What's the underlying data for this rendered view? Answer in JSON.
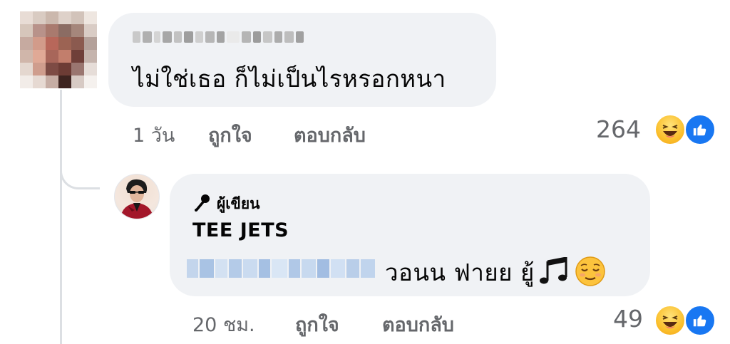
{
  "comment": {
    "text": "ไม่ใช่เธอ ก็ไม่เป็นไรหรอกหนา",
    "time": "1 วัน",
    "like_label": "ถูกใจ",
    "reply_label": "ตอบกลับ",
    "reaction_count": "264",
    "reactions": [
      "haha-icon",
      "like-icon"
    ]
  },
  "reply": {
    "author_badge": "ผู้เขียน",
    "author_name": "TEE JETS",
    "text": "วอนน ฟายย ยู้",
    "time": "20 ชม.",
    "like_label": "ถูกใจ",
    "reply_label": "ตอบกลับ",
    "reaction_count": "49",
    "reactions": [
      "haha-icon",
      "like-icon"
    ]
  },
  "colors": {
    "bubble": "#f0f2f5",
    "meta_text": "#65676b",
    "like_blue": "#1877f2",
    "thread_line": "#dcdfe3"
  }
}
